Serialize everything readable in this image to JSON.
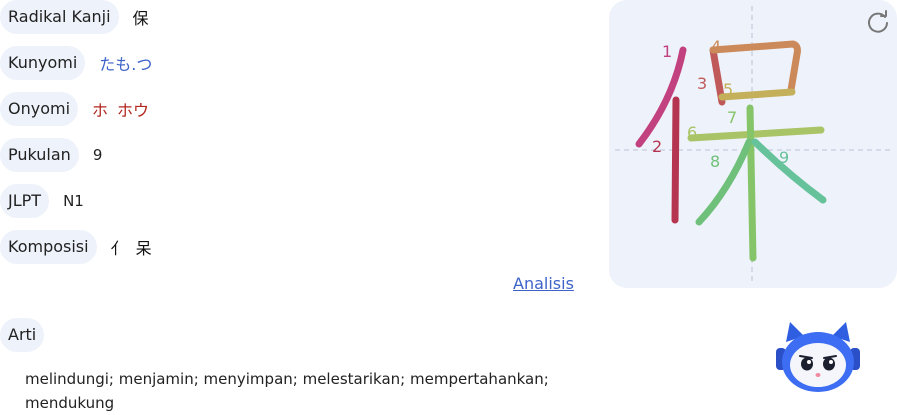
{
  "info": {
    "radical": {
      "label": "Radikal Kanji",
      "value": "保"
    },
    "kunyomi": {
      "label": "Kunyomi",
      "value": "たも.つ"
    },
    "onyomi": {
      "label": "Onyomi",
      "values": [
        "ホ",
        "ホウ"
      ]
    },
    "strokes": {
      "label": "Pukulan",
      "value": "9"
    },
    "jlpt": {
      "label": "JLPT",
      "value": "N1"
    },
    "composition": {
      "label": "Komposisi",
      "values": [
        "亻",
        "呆"
      ]
    }
  },
  "analysis_link": "Analisis",
  "meaning": {
    "label": "Arti",
    "text": "melindungi; menjamin; menyimpan; melestarikan; mempertahankan; mendukung"
  },
  "stroke_numbers": [
    "1",
    "2",
    "3",
    "4",
    "5",
    "6",
    "7",
    "8",
    "9"
  ],
  "icons": {
    "replay": "refresh-icon",
    "mascot": "robot-mascot-icon"
  },
  "colors": {
    "pill_bg": "#eef2fa",
    "link": "#3d63c9",
    "onyomi": "#b3261e",
    "stroke_colors": [
      "#c2417f",
      "#b5344f",
      "#c05a5a",
      "#cc8a5a",
      "#c4b05a",
      "#a9c466",
      "#86c46a",
      "#6fc07a",
      "#66c29a"
    ]
  }
}
